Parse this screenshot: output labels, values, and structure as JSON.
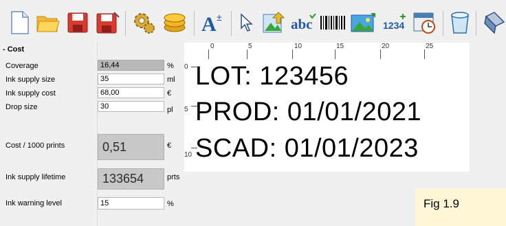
{
  "toolbar": {
    "icons": [
      "new-document-icon",
      "open-folder-icon",
      "save-icon",
      "save-as-icon",
      "settings-icon",
      "cost-coins-icon",
      "font-size-icon",
      "select-arrow-icon",
      "import-image-icon",
      "text-abc-icon",
      "barcode-icon",
      "image-icon",
      "counter-icon",
      "datetime-icon",
      "clear-icon",
      "more-icon"
    ],
    "counter_label": "1234",
    "text_label": "abc"
  },
  "cost": {
    "section_title": "- Cost",
    "coverage_label": "Coverage",
    "coverage_value": "16,44",
    "coverage_unit": "%",
    "ink_size_label": "Ink supply size",
    "ink_size_value": "35",
    "ink_size_unit": "ml",
    "ink_cost_label": "Ink supply cost",
    "ink_cost_value": "68,00",
    "ink_cost_unit": "€",
    "drop_label": "Drop size",
    "drop_value": "30",
    "drop_unit": "pl",
    "cost_per_label": "Cost / 1000 prints",
    "cost_per_value": "0,51",
    "cost_per_unit": "€",
    "lifetime_label": "Ink supply lifetime",
    "lifetime_value": "133654",
    "lifetime_unit": "prts",
    "warning_label": "Ink warning level",
    "warning_value": "15",
    "warning_unit": "%"
  },
  "preview": {
    "ruler_h": [
      "0",
      "5",
      "10",
      "15",
      "20",
      "25"
    ],
    "ruler_v": [
      "0",
      "5",
      "10"
    ],
    "lines": [
      "LOT: 123456",
      "PROD: 01/01/2021",
      "SCAD: 01/01/2023"
    ]
  },
  "figure_label": "Fig  1.9"
}
